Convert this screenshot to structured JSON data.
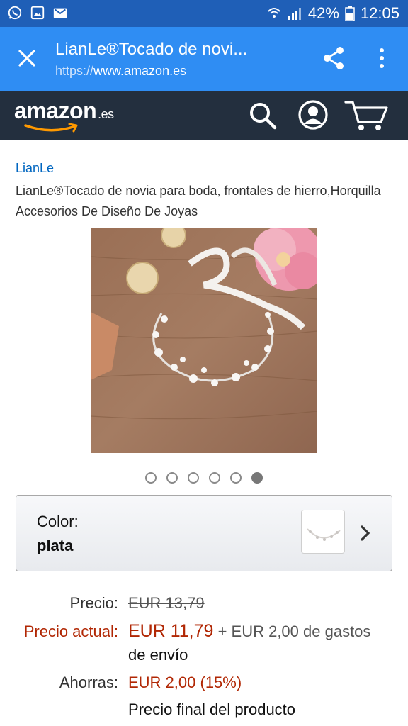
{
  "status_bar": {
    "battery": "42%",
    "time": "12:05"
  },
  "toolbar": {
    "title": "LianLe®Tocado de novi...",
    "url_scheme": "https://",
    "url_host": "www.amazon.es"
  },
  "amazon": {
    "logo_text": "amazon",
    "logo_tld": ".es"
  },
  "product": {
    "brand": "LianLe",
    "title": "LianLe®Tocado de novia para boda, frontales de hierro,Horquilla Accesorios De Diseño De Joyas",
    "image_count": 6,
    "active_image_index": 5
  },
  "variation": {
    "label": "Color:",
    "value": "plata"
  },
  "pricing": {
    "list_label": "Precio:",
    "list_price": "EUR 13,79",
    "current_label": "Precio actual:",
    "current_price": "EUR 11,79",
    "shipping": "+ EUR 2,00 de gastos",
    "shipping_line2": "de envío",
    "savings_label": "Ahorras:",
    "savings": "EUR 2,00 (15%)",
    "final_note": "Precio final del producto"
  },
  "colors": {
    "status_bar": "#1f5fb7",
    "toolbar": "#2f8df3",
    "amazon_header": "#232f3e",
    "amazon_orange": "#ff9900",
    "link_blue": "#0066c0",
    "price_red": "#b12704"
  }
}
